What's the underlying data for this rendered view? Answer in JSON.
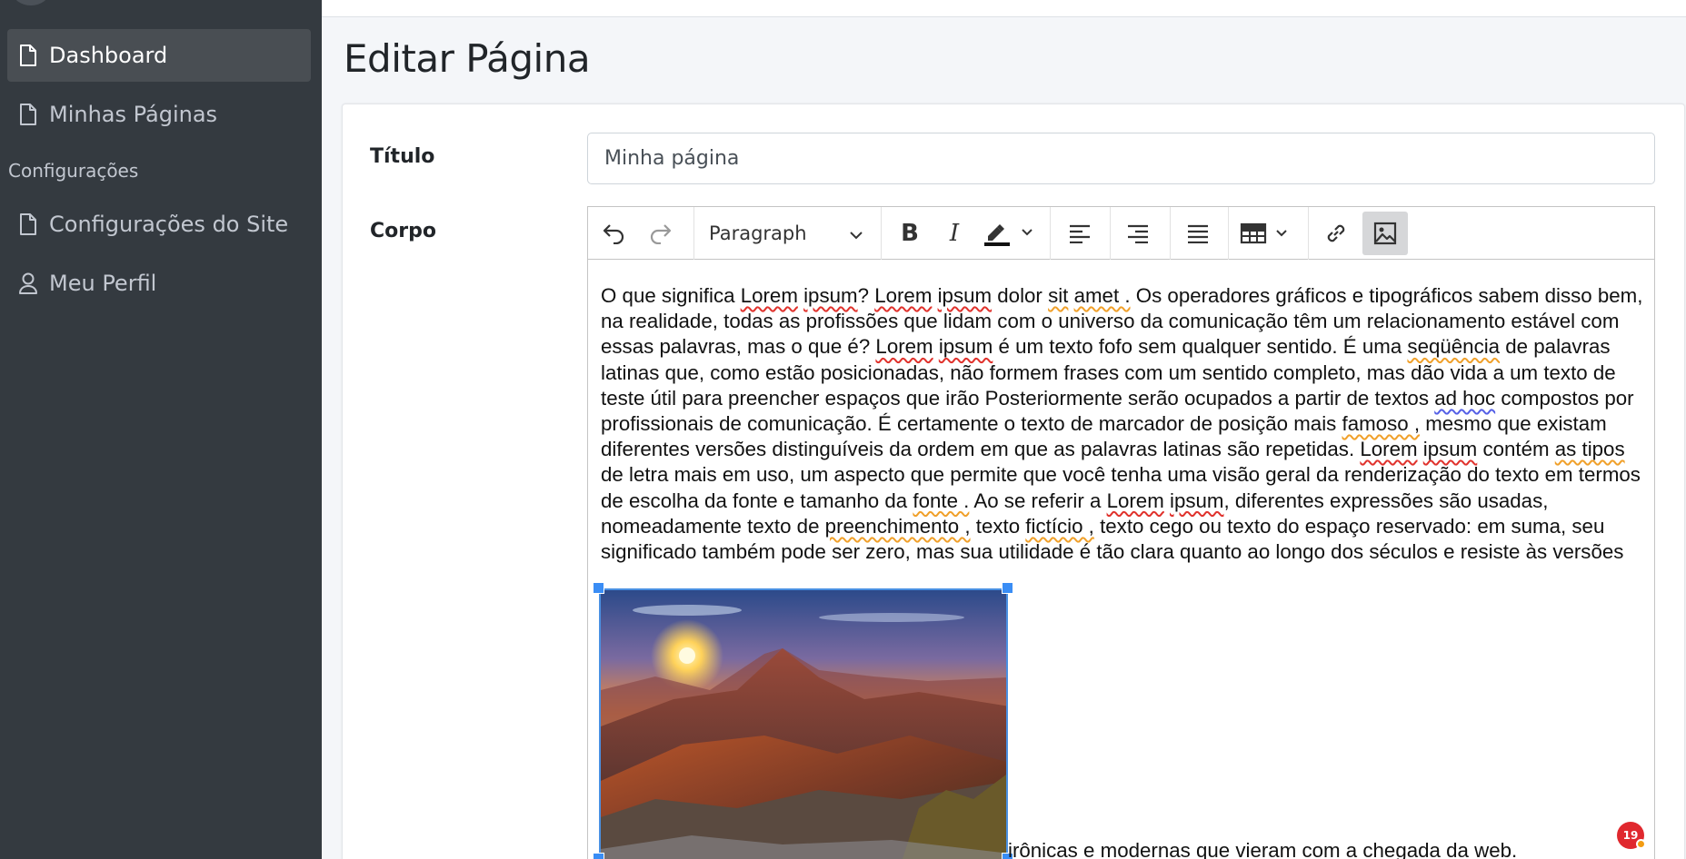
{
  "sidebar": {
    "items": [
      {
        "label": "Dashboard",
        "icon": "file-icon",
        "active": true
      },
      {
        "label": "Minhas Páginas",
        "icon": "file-icon",
        "active": false
      },
      {
        "label": "Configurações do Site",
        "icon": "file-icon",
        "active": false
      },
      {
        "label": "Meu Perfil",
        "icon": "user-icon",
        "active": false
      }
    ],
    "section_header": "Configurações"
  },
  "page": {
    "title": "Editar Página"
  },
  "form": {
    "title_label": "Título",
    "title_value": "Minha página",
    "body_label": "Corpo"
  },
  "editor": {
    "toolbar": {
      "heading_select": "Paragraph",
      "buttons": [
        "undo-icon",
        "redo-icon",
        "bold-icon",
        "italic-icon",
        "highlight-icon",
        "align-left-icon",
        "align-right-icon",
        "justify-icon",
        "table-icon",
        "link-icon",
        "image-icon"
      ]
    },
    "paragraph_segments": [
      {
        "t": "O que significa ",
        "s": ""
      },
      {
        "t": "Lorem",
        "s": "r"
      },
      {
        "t": " ",
        "s": ""
      },
      {
        "t": "ipsum",
        "s": "r"
      },
      {
        "t": "? ",
        "s": ""
      },
      {
        "t": "Lorem",
        "s": "r"
      },
      {
        "t": " ",
        "s": ""
      },
      {
        "t": "ipsum",
        "s": "r"
      },
      {
        "t": " dolor ",
        "s": ""
      },
      {
        "t": "sit",
        "s": "o"
      },
      {
        "t": " ",
        "s": ""
      },
      {
        "t": "amet .",
        "s": "o"
      },
      {
        "t": " Os operadores gráficos e tipográficos sabem disso bem, na realidade, todas as profissões que lidam com o universo da comunicação têm um relacionamento estável com essas palavras, mas o que é? ",
        "s": ""
      },
      {
        "t": "Lorem",
        "s": "r"
      },
      {
        "t": " ",
        "s": ""
      },
      {
        "t": "ipsum",
        "s": "r"
      },
      {
        "t": " é um texto fofo sem qualquer sentido. É uma ",
        "s": ""
      },
      {
        "t": "seqüência",
        "s": "o"
      },
      {
        "t": " de palavras latinas que, como estão posicionadas, não formem frases com um sentido completo, mas dão vida a um texto de teste útil para preencher espaços que irão Posteriormente serão ocupados a partir de textos ",
        "s": ""
      },
      {
        "t": "ad hoc",
        "s": "b"
      },
      {
        "t": " compostos por profissionais de comunicação. É certamente o texto de marcador de posição mais ",
        "s": ""
      },
      {
        "t": "famoso ,",
        "s": "o"
      },
      {
        "t": " mesmo que existam diferentes versões distinguíveis da ordem em que as palavras latinas são repetidas. ",
        "s": ""
      },
      {
        "t": "Lorem",
        "s": "r"
      },
      {
        "t": " ",
        "s": ""
      },
      {
        "t": "ipsum",
        "s": "r"
      },
      {
        "t": " contém ",
        "s": ""
      },
      {
        "t": "as tipos",
        "s": "o"
      },
      {
        "t": " de letra mais em uso, um aspecto que permite que você tenha uma visão geral da renderização do texto em termos de escolha da fonte e tamanho da ",
        "s": ""
      },
      {
        "t": "fonte .",
        "s": "o"
      },
      {
        "t": " Ao se referir a ",
        "s": ""
      },
      {
        "t": "Lorem",
        "s": "r"
      },
      {
        "t": " ",
        "s": ""
      },
      {
        "t": "ipsum",
        "s": "r"
      },
      {
        "t": ", diferentes expressões são usadas, nomeadamente texto de ",
        "s": ""
      },
      {
        "t": "preenchimento ,",
        "s": "o"
      },
      {
        "t": " texto ",
        "s": ""
      },
      {
        "t": "fictício ,",
        "s": "o"
      },
      {
        "t": " texto cego ou texto do espaço reservado: em suma, seu significado também pode ser zero, mas sua utilidade é tão clara quanto ao longo dos séculos e resiste às versões",
        "s": ""
      }
    ],
    "after_image_text": "irônicas e modernas que vieram com a chegada da web."
  },
  "notification": {
    "count": "19"
  },
  "colors": {
    "sidebar_bg": "#343a40",
    "active_item_bg": "#494e53",
    "spell_error": "#e0322c",
    "grammar_warning": "#f0a02a",
    "style_hint": "#5560e6",
    "selection_blue": "#4a90e2",
    "badge_red": "#e0282e"
  }
}
